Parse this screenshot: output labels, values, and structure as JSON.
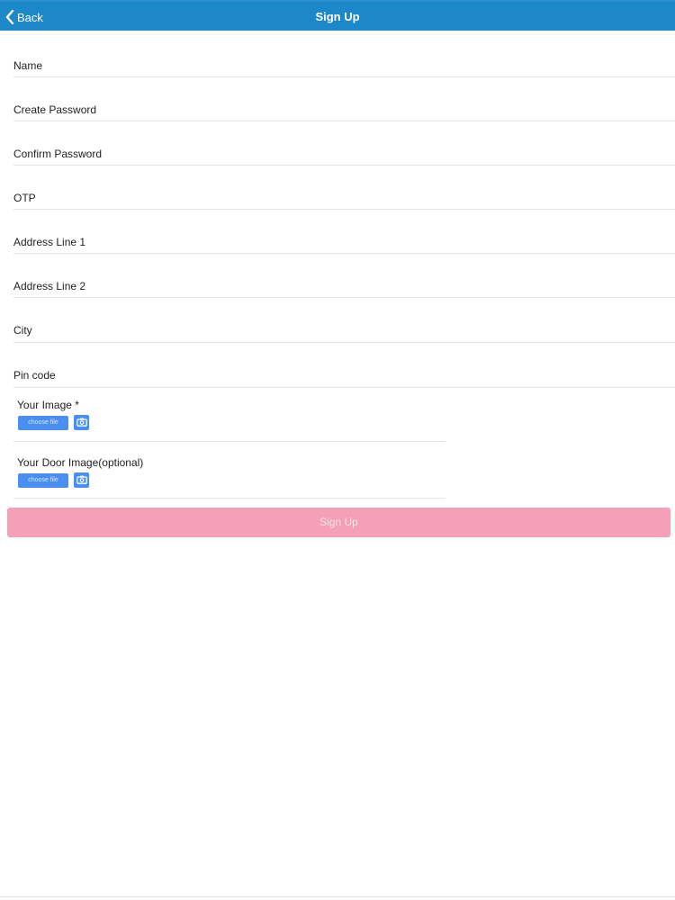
{
  "navbar": {
    "back_label": "Back",
    "title": "Sign Up",
    "color": "#1c87c9"
  },
  "form": {
    "fields": [
      {
        "label": "Name"
      },
      {
        "label": "Create Password"
      },
      {
        "label": "Confirm Password"
      },
      {
        "label": "OTP"
      },
      {
        "label": "Address Line 1"
      },
      {
        "label": "Address Line 2"
      },
      {
        "label": "City"
      },
      {
        "label": "Pin code"
      }
    ],
    "uploads": [
      {
        "label": "Your Image *",
        "button_label": "choose file",
        "icon": "camera-icon"
      },
      {
        "label": "Your Door Image(optional)",
        "button_label": "choose file",
        "icon": "camera-icon"
      }
    ],
    "submit_label": "Sign Up",
    "submit_color": "#f4a0b8"
  }
}
